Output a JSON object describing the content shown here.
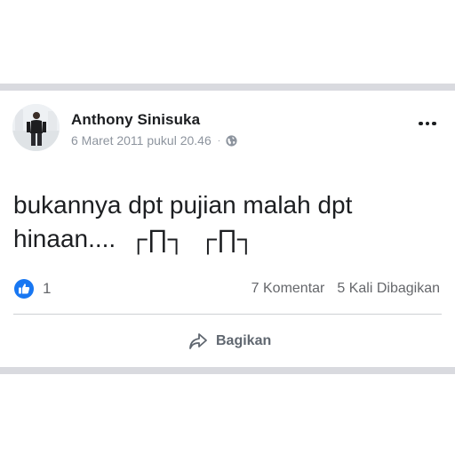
{
  "post": {
    "author": "Anthony Sinisuka",
    "timestamp": "6 Maret 2011 pukul 20.46",
    "separator": "·",
    "privacy_icon": "globe-icon",
    "text_line1": "bukannya dpt pujian malah dpt",
    "text_line2": "hinaan....  ┌∏┐  ┌∏┐"
  },
  "engagement": {
    "like_count": "1",
    "comments": "7 Komentar",
    "shares": "5 Kali Dibagikan"
  },
  "actions": {
    "share_label": "Bagikan",
    "share_icon": "share-arrow-icon",
    "more_icon": "more-options-icon"
  },
  "colors": {
    "like_blue": "#1877f2",
    "text": "#1c1e21",
    "muted": "#65676b",
    "band": "#d9dadf"
  }
}
